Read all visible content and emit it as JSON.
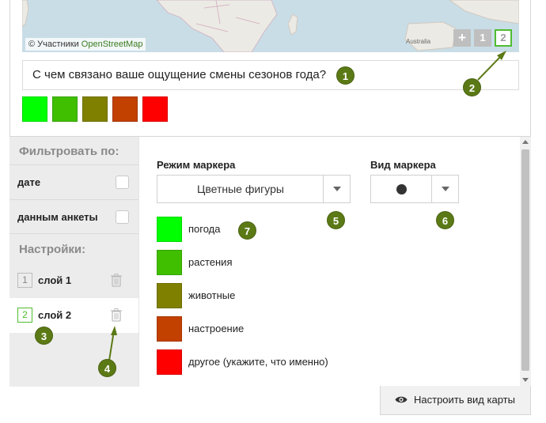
{
  "map": {
    "attribution_prefix": "© Участники ",
    "attribution_link": "OpenStreetMap",
    "region_label": "Australia",
    "layer_buttons": [
      "+",
      "1",
      "2"
    ]
  },
  "question": {
    "text": "С чем связано ваше ощущение смены сезонов года?"
  },
  "colors": {
    "weather": "#00ff00",
    "plants": "#3fbf00",
    "animals": "#808000",
    "mood": "#c24000",
    "other": "#ff0000",
    "accent": "#4fbd30",
    "badge": "#5b7a16"
  },
  "sidebar": {
    "filter_heading": "Фильтровать по:",
    "filters": [
      {
        "label": "дате"
      },
      {
        "label": "данным анкеты"
      }
    ],
    "settings_heading": "Настройки:",
    "layers": [
      {
        "number": "1",
        "label": "слой 1"
      },
      {
        "number": "2",
        "label": "слой 2"
      }
    ]
  },
  "content": {
    "marker_mode_label": "Режим маркера",
    "marker_mode_value": "Цветные фигуры",
    "marker_view_label": "Вид маркера",
    "legend": [
      {
        "label": "погода"
      },
      {
        "label": "растения"
      },
      {
        "label": "животные"
      },
      {
        "label": "настроение"
      },
      {
        "label": "другое (укажите, что именно)"
      }
    ]
  },
  "footer": {
    "configure_button": "Настроить вид карты"
  },
  "badges": [
    "1",
    "2",
    "3",
    "4",
    "5",
    "6",
    "7"
  ]
}
